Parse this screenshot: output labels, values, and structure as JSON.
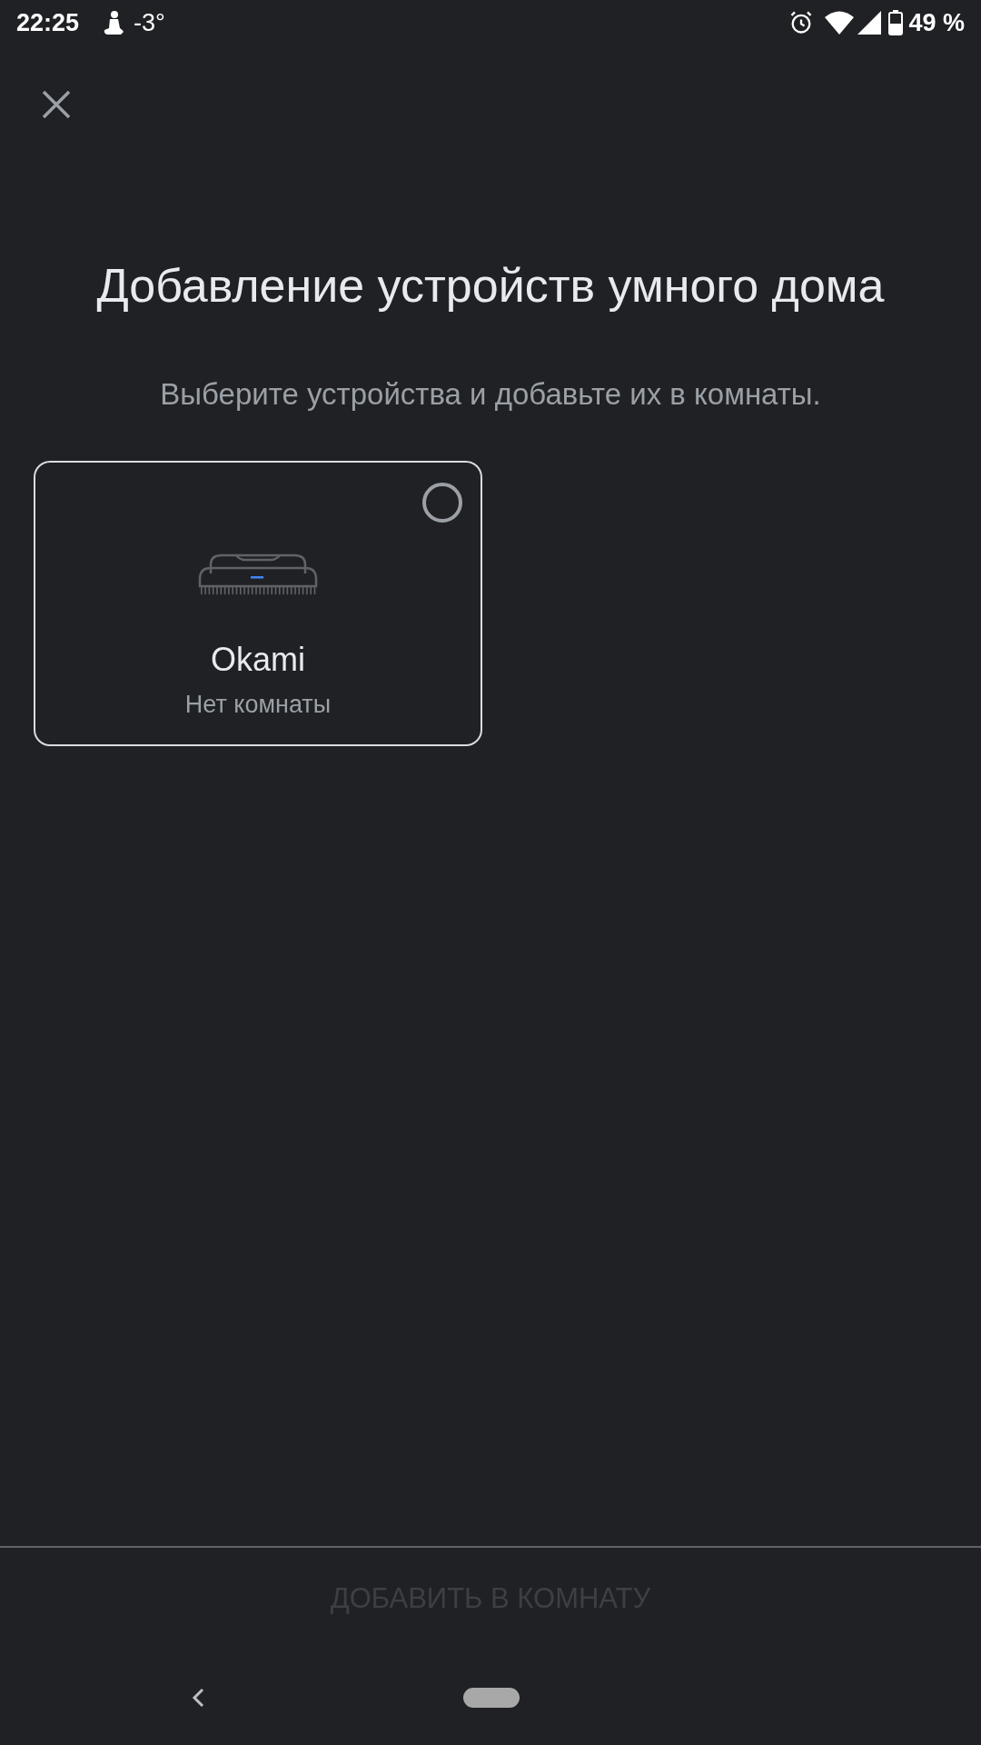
{
  "status_bar": {
    "time": "22:25",
    "temperature": "-3°",
    "battery": "49 %"
  },
  "title": "Добавление устройств умного дома",
  "subtitle": "Выберите устройства и добавьте их в комнаты.",
  "devices": [
    {
      "name": "Okami",
      "room": "Нет комнаты",
      "selected": false
    }
  ],
  "action_button": {
    "label": "ДОБАВИТЬ В КОМНАТУ",
    "disabled": true
  }
}
